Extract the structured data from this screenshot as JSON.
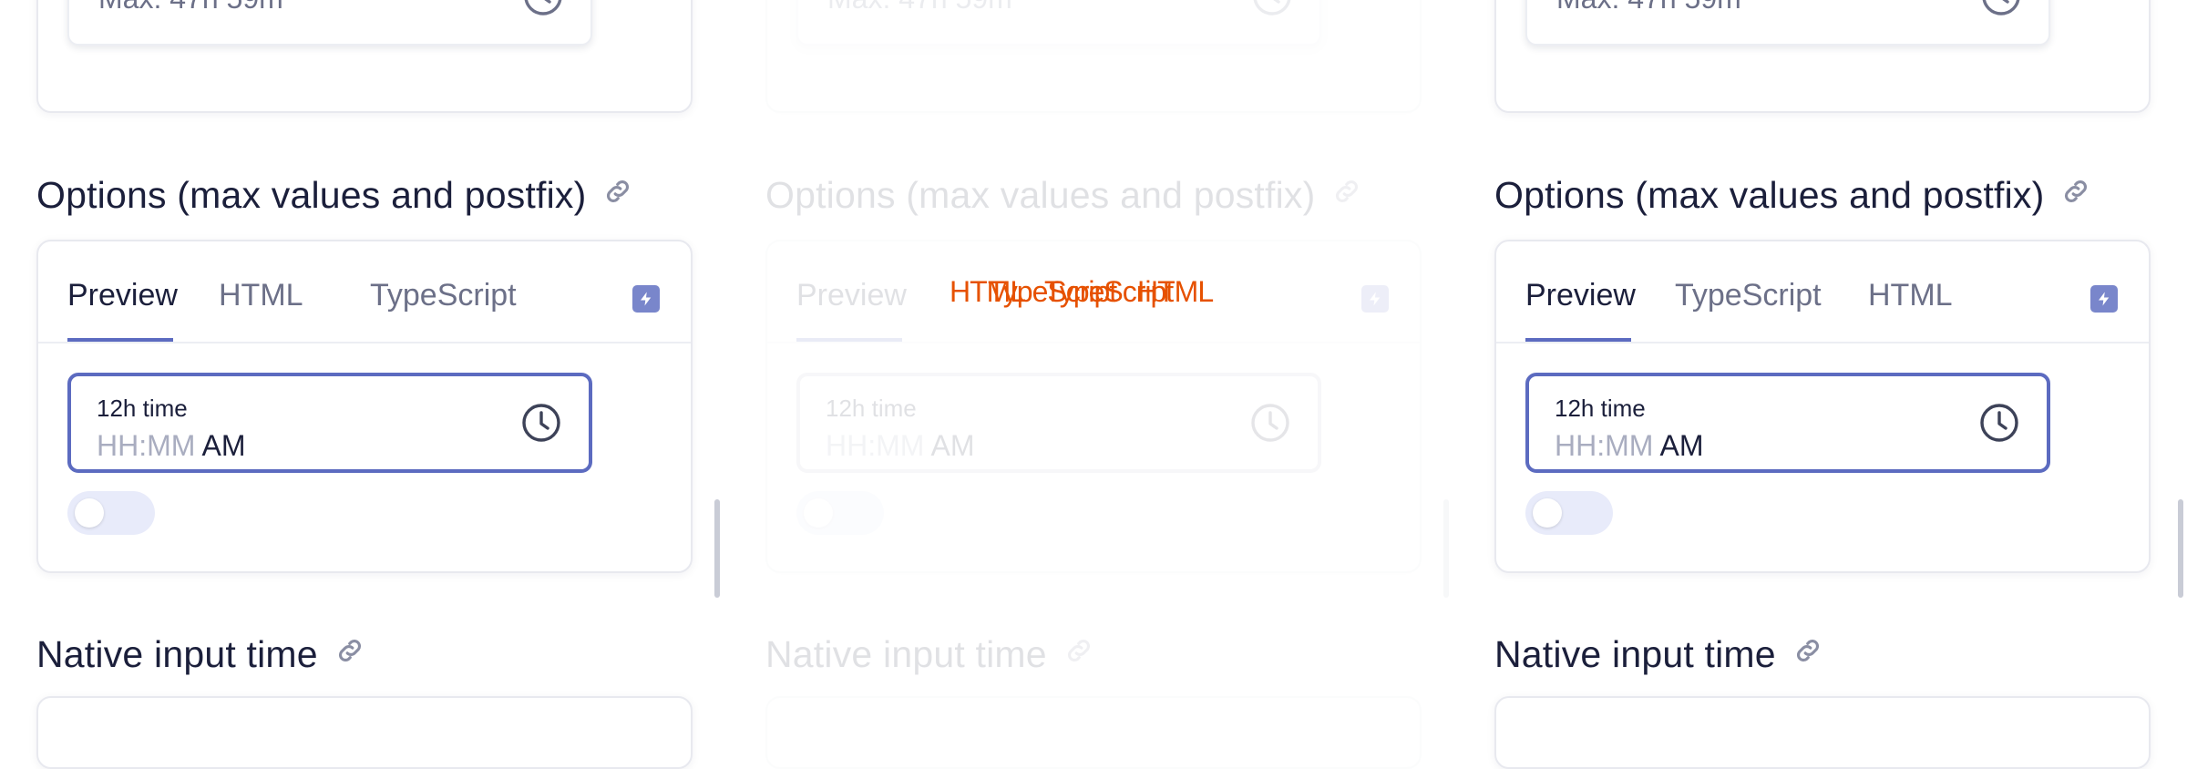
{
  "colors": {
    "accent": "#5c6bc0",
    "overlay": "#e65100",
    "heading": "#1b1f3b",
    "muted": "#6c7088"
  },
  "top_field": {
    "value": "Max: 47h 59m",
    "icon": "clock-icon"
  },
  "section_options": {
    "title": "Options (max values and postfix)",
    "icon": "link-icon"
  },
  "section_native": {
    "title": "Native input time",
    "icon": "link-icon"
  },
  "tabs_left": [
    {
      "label": "Preview"
    },
    {
      "label": "HTML"
    },
    {
      "label": "TypeScript"
    }
  ],
  "tabs_right": [
    {
      "label": "Preview"
    },
    {
      "label": "TypeScript"
    },
    {
      "label": "HTML"
    }
  ],
  "active_tab": "Preview",
  "time_field": {
    "label": "12h time",
    "placeholder": "HH:MM",
    "postfix": "AM",
    "icon": "clock-icon"
  },
  "toggle": {
    "checked": false
  },
  "overlay_labels": [
    "HTML",
    "TypeScript",
    "TypeScript",
    "HTML"
  ]
}
